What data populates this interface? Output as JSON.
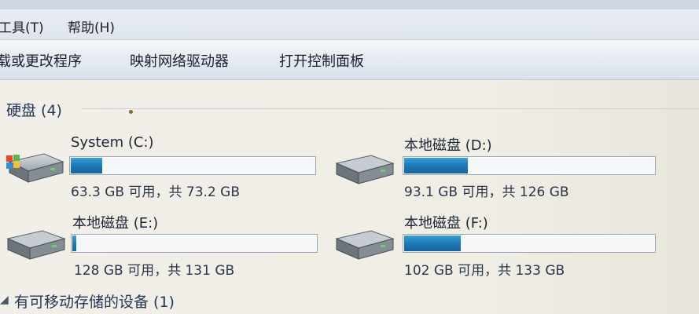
{
  "menu": {
    "tools": "工具(T)",
    "help": "帮助(H)"
  },
  "toolbar": {
    "uninstall": "载或更改程序",
    "map_drive": "映射网络驱动器",
    "control_panel": "打开控制面板"
  },
  "groups": {
    "hdd": {
      "title": "硬盘 (4)"
    },
    "removable": {
      "title": "有可移动存储的设备 (1)"
    }
  },
  "drives": [
    {
      "name": "System (C:)",
      "size_text": "63.3 GB 可用，共 73.2 GB",
      "used_fraction": 0.135,
      "windows_logo": true
    },
    {
      "name": "本地磁盘 (D:)",
      "size_text": "93.1 GB 可用，共 126 GB",
      "used_fraction": 0.26
    },
    {
      "name": "本地磁盘 (E:)",
      "size_text": "128 GB 可用，共 131 GB",
      "used_fraction": 0.023
    },
    {
      "name": "本地磁盘 (F:)",
      "size_text": "102 GB 可用，共 133 GB",
      "used_fraction": 0.23
    }
  ],
  "colors": {
    "bar_fill": "#1c79b5",
    "group_header": "#24375a"
  }
}
